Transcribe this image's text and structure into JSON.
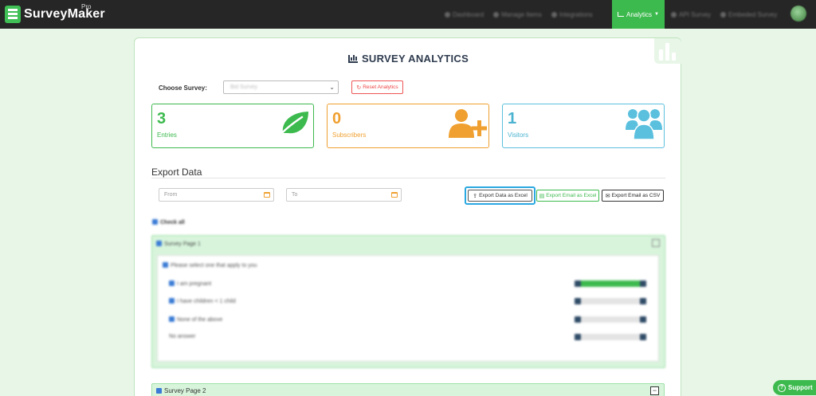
{
  "app": {
    "name": "SurveyMaker",
    "badge": "Pro"
  },
  "nav": {
    "items": [
      {
        "label": "Dashboard"
      },
      {
        "label": "Manage Items"
      },
      {
        "label": "Integrations"
      },
      {
        "label": "Analytics"
      },
      {
        "label": "API Survey"
      },
      {
        "label": "Embeded Survey"
      }
    ],
    "active_label": "Analytics",
    "accent": "#3dba4e"
  },
  "page": {
    "title": "SURVEY ANALYTICS"
  },
  "filters": {
    "choose_label": "Choose Survey:",
    "selected_survey": "Bid Survey",
    "reset_label": "Reset Analytics"
  },
  "stats": [
    {
      "value": "3",
      "label": "Entries",
      "icon": "leaf-icon",
      "color": "#3dba4e"
    },
    {
      "value": "0",
      "label": "Subscribers",
      "icon": "add-user-icon",
      "color": "#f0a030"
    },
    {
      "value": "1",
      "label": "Visitors",
      "icon": "users-icon",
      "color": "#5bc0de"
    }
  ],
  "export": {
    "title": "Export Data",
    "from_placeholder": "From",
    "to_placeholder": "To",
    "buttons": {
      "data_excel": "Export Data as Excel",
      "email_excel": "Export Email as Excel",
      "email_csv": "Export Email as CSV"
    }
  },
  "results": {
    "check_all": "Check all",
    "page1": {
      "title": "Survey Page 1",
      "question": "Please select one that apply to you",
      "options": [
        {
          "label": "I am pregnant",
          "percent": 100
        },
        {
          "label": "I have children < 1 child",
          "percent": 0
        },
        {
          "label": "None of the above",
          "percent": 0
        },
        {
          "label": "No answer",
          "percent": 0
        }
      ]
    },
    "page2": {
      "title": "Survey Page 2"
    }
  },
  "support": {
    "label": "Support"
  }
}
